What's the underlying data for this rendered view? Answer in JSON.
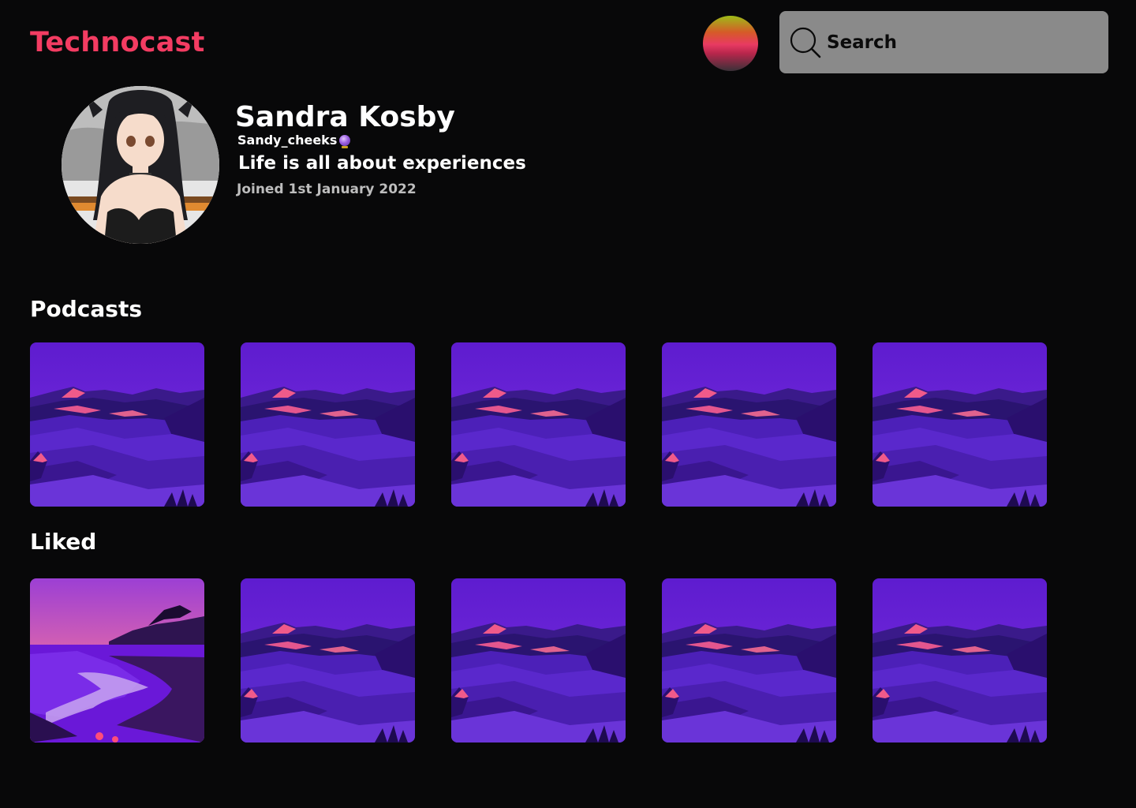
{
  "header": {
    "logo": "Technocast",
    "search": {
      "placeholder": "Search"
    }
  },
  "profile": {
    "name": "Sandra Kosby",
    "handle": "Sandy_cheeks",
    "bio": "Life is all about experiences",
    "joined": "Joined 1st January 2022"
  },
  "sections": {
    "podcasts": {
      "title": "Podcasts",
      "items": [
        {
          "artwork": "purple-mountains"
        },
        {
          "artwork": "purple-mountains"
        },
        {
          "artwork": "purple-mountains"
        },
        {
          "artwork": "purple-mountains"
        },
        {
          "artwork": "purple-mountains"
        }
      ]
    },
    "liked": {
      "title": "Liked",
      "items": [
        {
          "artwork": "pink-coast"
        },
        {
          "artwork": "purple-mountains"
        },
        {
          "artwork": "purple-mountains"
        },
        {
          "artwork": "purple-mountains"
        },
        {
          "artwork": "purple-mountains"
        }
      ]
    }
  },
  "colors": {
    "background": "#080809",
    "brand": "#f33c62",
    "search_bg": "#8a8a8a",
    "muted_text": "#bdbdbd"
  },
  "icons": {
    "search": "search-icon",
    "avatar": "user-avatar",
    "verified": "crystal-ball-badge"
  }
}
